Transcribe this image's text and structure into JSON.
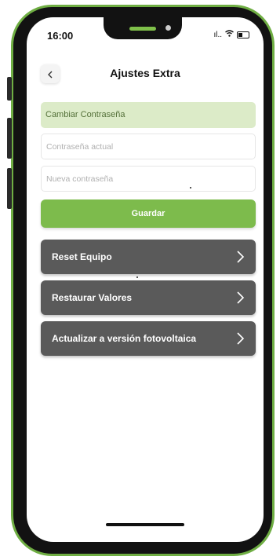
{
  "status": {
    "time": "16:00"
  },
  "header": {
    "back_icon": "chevron-left-icon",
    "title": "Ajustes Extra"
  },
  "password": {
    "section_label": "Cambiar Contraseña",
    "current_placeholder": "Contraseña actual",
    "new_placeholder": "Nueva contraseña",
    "save_label": "Guardar"
  },
  "actions": [
    {
      "label": "Reset Equipo"
    },
    {
      "label": "Restaurar Valores"
    },
    {
      "label": "Actualizar a versión fotovoltaica"
    }
  ],
  "colors": {
    "accent": "#7dbb4c",
    "section_bg": "#dcebc8",
    "action_bg": "#5a5a5a",
    "frame_border": "#6fae43"
  }
}
